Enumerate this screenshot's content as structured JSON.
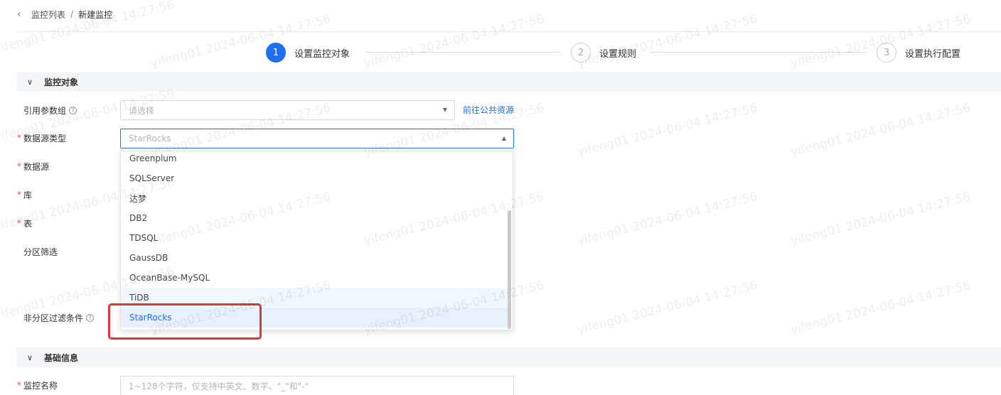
{
  "breadcrumb": {
    "parent": "监控列表",
    "separator": "/",
    "current": "新建监控"
  },
  "steps": [
    {
      "number": "1",
      "label": "设置监控对象",
      "state": "active"
    },
    {
      "number": "2",
      "label": "设置规则",
      "state": "inactive"
    },
    {
      "number": "3",
      "label": "设置执行配置",
      "state": "inactive"
    }
  ],
  "section_monitor": {
    "title": "监控对象"
  },
  "section_basic": {
    "title": "基础信息"
  },
  "form": {
    "param_group": {
      "label": "引用参数组",
      "placeholder": "请选择",
      "link": "前往公共资源"
    },
    "datasource_type": {
      "label": "数据源类型",
      "value": "StarRocks"
    },
    "datasource": {
      "label": "数据源"
    },
    "database": {
      "label": "库"
    },
    "table": {
      "label": "表"
    },
    "partition_filter": {
      "label": "分区筛选"
    },
    "non_partition_filter": {
      "label": "非分区过滤条件"
    },
    "monitor_name": {
      "label": "监控名称",
      "placeholder": "1~128个字符，仅支持中英文、数字、\"_\"和\"-\""
    }
  },
  "dropdown_options": [
    {
      "label": "Greenplum",
      "state": "normal"
    },
    {
      "label": "SQLServer",
      "state": "normal"
    },
    {
      "label": "达梦",
      "state": "normal"
    },
    {
      "label": "DB2",
      "state": "normal"
    },
    {
      "label": "TDSQL",
      "state": "normal"
    },
    {
      "label": "GaussDB",
      "state": "normal"
    },
    {
      "label": "OceanBase-MySQL",
      "state": "normal"
    },
    {
      "label": "TiDB",
      "state": "hover"
    },
    {
      "label": "StarRocks",
      "state": "selected"
    }
  ],
  "watermark_text": "yifeng01 2024-06-04 14:27:56",
  "colors": {
    "primary": "#1e6ff1",
    "required": "#e34d59",
    "highlight": "#d9363e",
    "section_bg": "#f4f5f7"
  }
}
